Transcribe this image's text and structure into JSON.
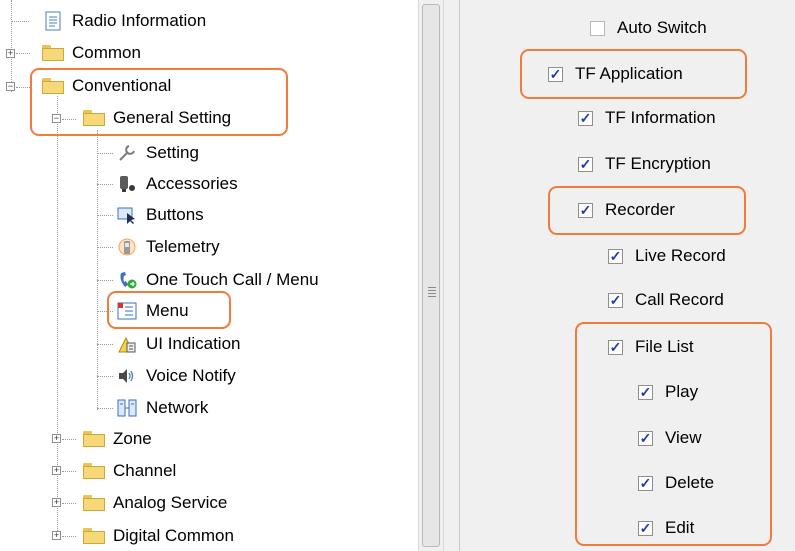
{
  "tree": {
    "items": [
      {
        "label": "Radio Information"
      },
      {
        "label": "Common"
      },
      {
        "label": "Conventional"
      },
      {
        "label": "General Setting"
      },
      {
        "label": "Setting"
      },
      {
        "label": "Accessories"
      },
      {
        "label": "Buttons"
      },
      {
        "label": "Telemetry"
      },
      {
        "label": "One Touch Call / Menu"
      },
      {
        "label": "Menu"
      },
      {
        "label": "UI Indication"
      },
      {
        "label": "Voice Notify"
      },
      {
        "label": "Network"
      },
      {
        "label": "Zone"
      },
      {
        "label": "Channel"
      },
      {
        "label": "Analog Service"
      },
      {
        "label": "Digital Common"
      }
    ]
  },
  "options": {
    "items": [
      {
        "label": "Auto Switch",
        "checked": false
      },
      {
        "label": "TF Application",
        "checked": true
      },
      {
        "label": "TF Information",
        "checked": true
      },
      {
        "label": "TF Encryption",
        "checked": true
      },
      {
        "label": "Recorder",
        "checked": true
      },
      {
        "label": "Live Record",
        "checked": true
      },
      {
        "label": "Call Record",
        "checked": true
      },
      {
        "label": "File List",
        "checked": true
      },
      {
        "label": "Play",
        "checked": true
      },
      {
        "label": "View",
        "checked": true
      },
      {
        "label": "Delete",
        "checked": true
      },
      {
        "label": "Edit",
        "checked": true
      }
    ]
  },
  "colors": {
    "highlight": "#f07c3c",
    "check": "#1f3fa8",
    "folder": "#f5d978",
    "panel_bg": "#f0f0f0"
  }
}
